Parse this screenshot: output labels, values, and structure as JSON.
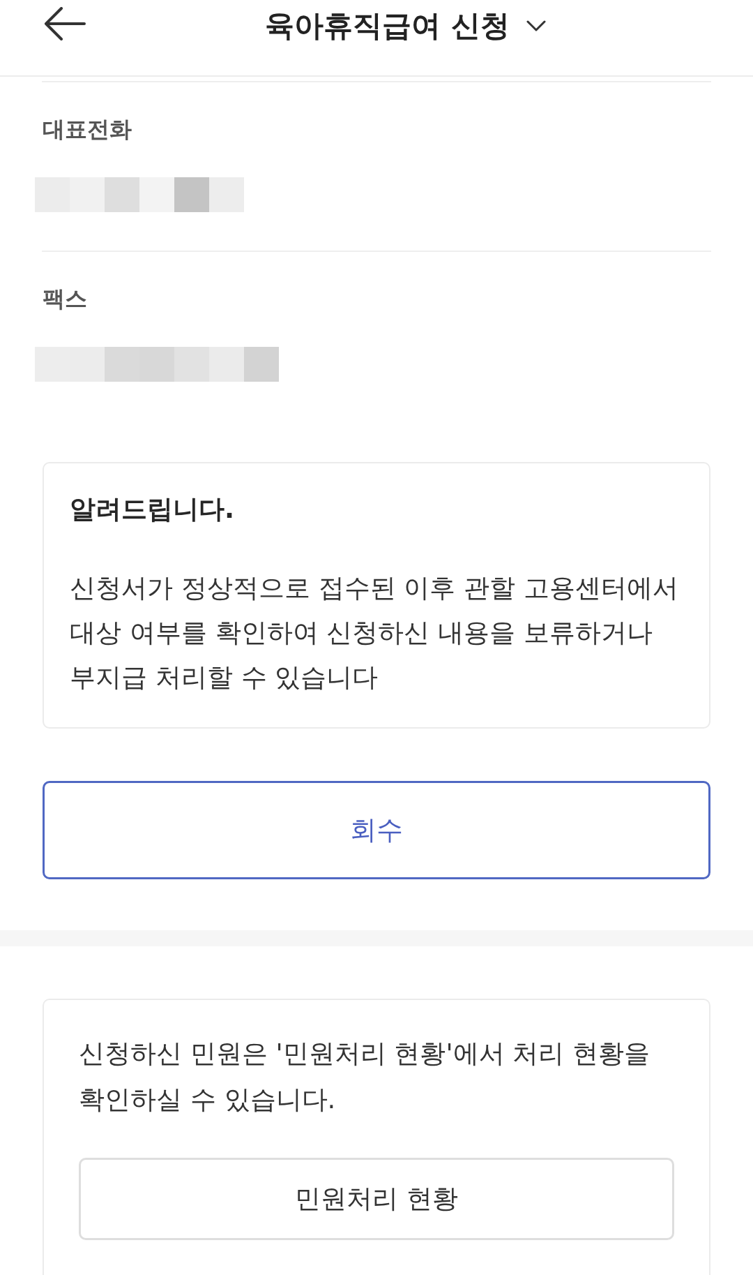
{
  "header": {
    "title": "육아휴직급여 신청"
  },
  "contact_fields": [
    {
      "label": "대표전화",
      "redacted": true
    },
    {
      "label": "팩스",
      "redacted": true
    }
  ],
  "notice": {
    "title": "알려드립니다.",
    "body": "신청서가 정상적으로 접수된 이후 관할 고용센터에서 대상 여부를 확인하여 신청하신 내용을 보류하거나 부지급 처리할 수 있습니다"
  },
  "withdraw_button": {
    "label": "회수"
  },
  "status_card": {
    "text": "신청하신 민원은 '민원처리 현황'에서 처리 현황을 확인하실 수 있습니다.",
    "button": "민원처리 현황"
  }
}
